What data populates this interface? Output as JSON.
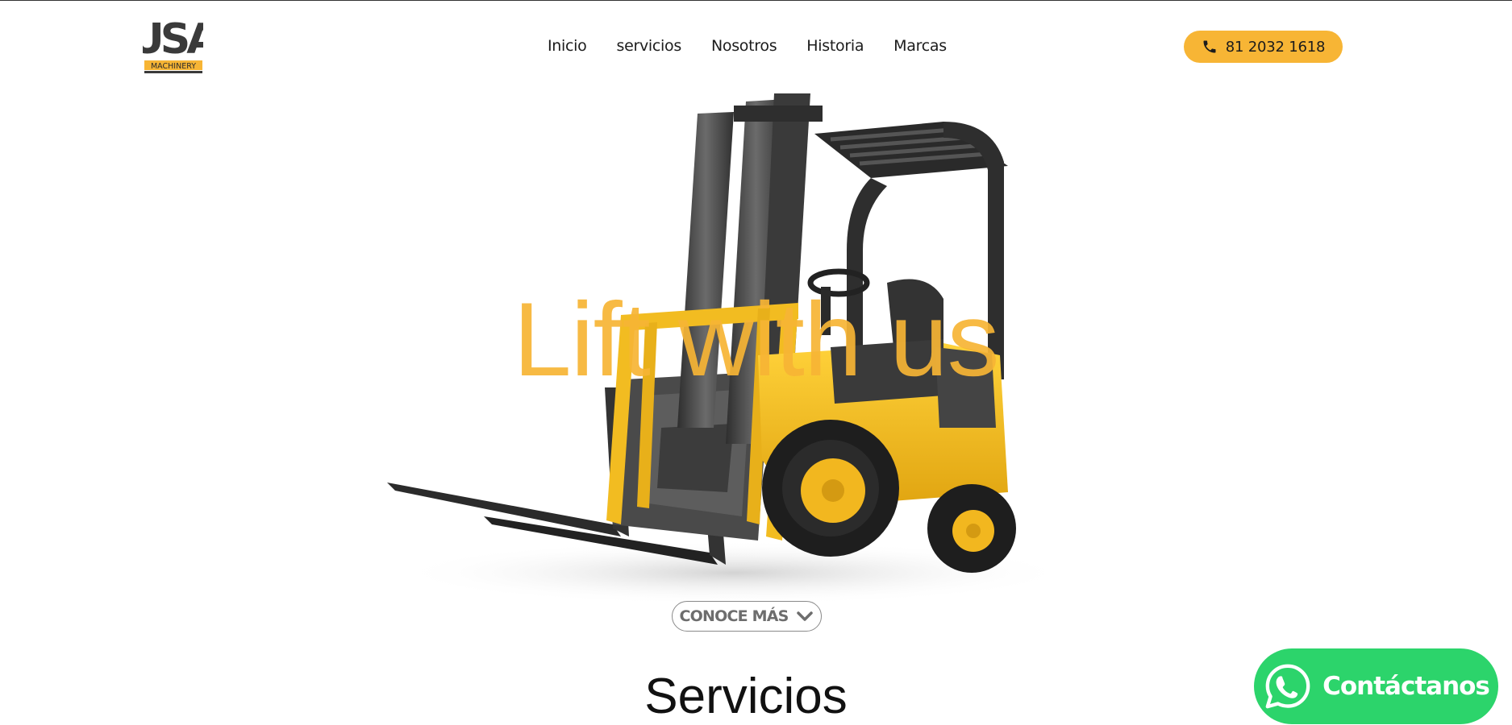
{
  "header": {
    "logo": {
      "text": "USA",
      "subtext": "MACHINERY"
    },
    "nav": [
      {
        "label": "Inicio"
      },
      {
        "label": "servicios"
      },
      {
        "label": "Nosotros"
      },
      {
        "label": "Historia"
      },
      {
        "label": "Marcas"
      }
    ],
    "phone": {
      "label": "81 2032 1618",
      "icon": "phone-icon"
    }
  },
  "hero": {
    "title": "Lift with us",
    "image": "forklift",
    "more_button": {
      "label": "CONOCE MÁS",
      "icon": "chevron-down-icon"
    }
  },
  "section": {
    "title": "Servicios"
  },
  "whatsapp": {
    "label": "Contáctanos",
    "icon": "whatsapp-icon"
  },
  "colors": {
    "accent": "#f7b535",
    "whatsapp": "#2cd46b",
    "text": "#1c1c1c"
  }
}
